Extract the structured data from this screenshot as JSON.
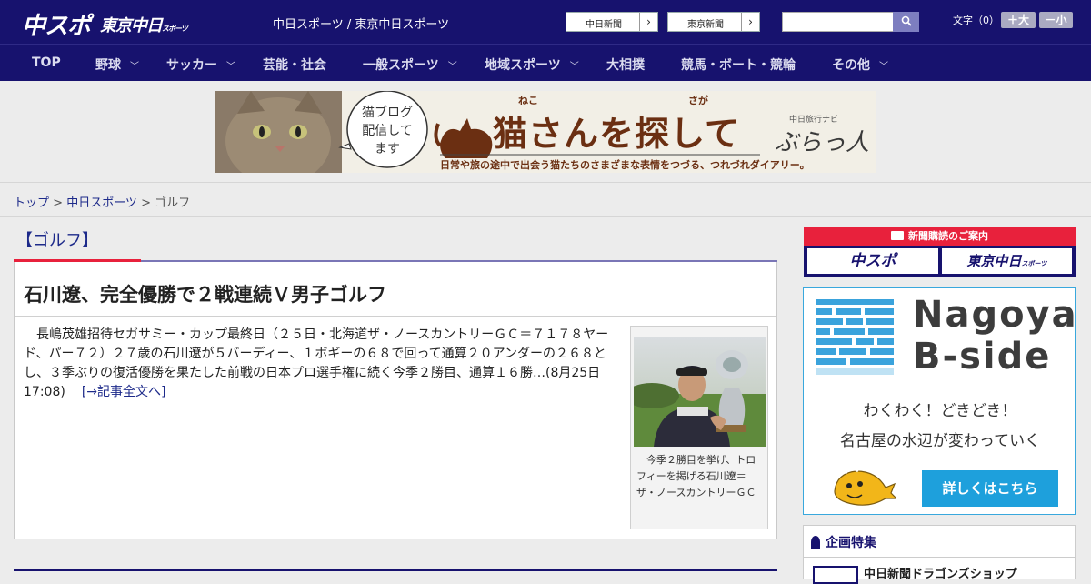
{
  "header": {
    "logo_chunichi_sports": "中スポ",
    "logo_tokyo_chunichi": "東京中日",
    "logo_tokyo_chunichi_sub": "スポーツ",
    "site_title": "中日スポーツ / 東京中日スポーツ",
    "site_links": [
      {
        "label": "中日新聞",
        "arrow": "›"
      },
      {
        "label": "東京新聞",
        "arrow": "›"
      }
    ],
    "search_placeholder": "",
    "font_size_label": "文字（0）",
    "font_larger": "＋大",
    "font_smaller": "－小"
  },
  "nav": [
    {
      "label": "TOP",
      "has_menu": false
    },
    {
      "label": "野球",
      "has_menu": true
    },
    {
      "label": "サッカー",
      "has_menu": true
    },
    {
      "label": "芸能・社会",
      "has_menu": false
    },
    {
      "label": "一般スポーツ",
      "has_menu": true
    },
    {
      "label": "地域スポーツ",
      "has_menu": true
    },
    {
      "label": "大相撲",
      "has_menu": false
    },
    {
      "label": "競馬・ボート・競輪",
      "has_menu": false
    },
    {
      "label": "その他",
      "has_menu": true
    }
  ],
  "banner": {
    "bubble_text": "猫ブログ配信してます",
    "title": "猫さんを探して",
    "ruby_neko": "ねこ",
    "ruby_saga": "さが",
    "brand_small": "中日旅行ナビ",
    "brand": "ぶらっ人",
    "tagline": "日常や旅の途中で出会う猫たちのさまざまな表情をつづる、つれづれダイアリー。"
  },
  "breadcrumb": {
    "top": "トップ",
    "sep": " > ",
    "section": "中日スポーツ",
    "current": "ゴルフ"
  },
  "category": "【ゴルフ】",
  "article": {
    "headline": "石川遼、完全優勝で２戦連続Ｖ男子ゴルフ",
    "summary": "長嶋茂雄招待セガサミー・カップ最終日（２５日・北海道ザ・ノースカントリーＧＣ＝７１７８ヤード、パー７２）２７歳の石川遼が５バーディー、１ボギーの６８で回って通算２０アンダーの２６８とし、３季ぶりの復活優勝を果たした前戦の日本プロ選手権に続く今季２勝目、通算１６勝…(8月25日 17:08)",
    "more_link": "[→記事全文へ]",
    "photo_caption": "今季２勝目を挙げ、トロフィーを掲げる石川遼＝ザ・ノースカントリーＧＣ"
  },
  "sidebar": {
    "subscribe_title": "新聞購読のご案内",
    "subscribe_logo_1": "中スポ",
    "subscribe_logo_2": "東京中日",
    "subscribe_logo_2_sub": "スポーツ",
    "ad": {
      "title_line1": "Nagoya",
      "title_line2": "B-side",
      "copy_line1": "わくわく！どきどき！",
      "copy_line2": "名古屋の水辺が変わっていく",
      "button": "詳しくはこちら"
    },
    "features_title": "企画特集",
    "features_item": "中日新聞ドラゴンズショップ"
  },
  "colors": {
    "brand_navy": "#17126e",
    "accent_red": "#e8213c",
    "link_blue": "#1d2a8a",
    "ad_blue": "#1ea0dc"
  }
}
